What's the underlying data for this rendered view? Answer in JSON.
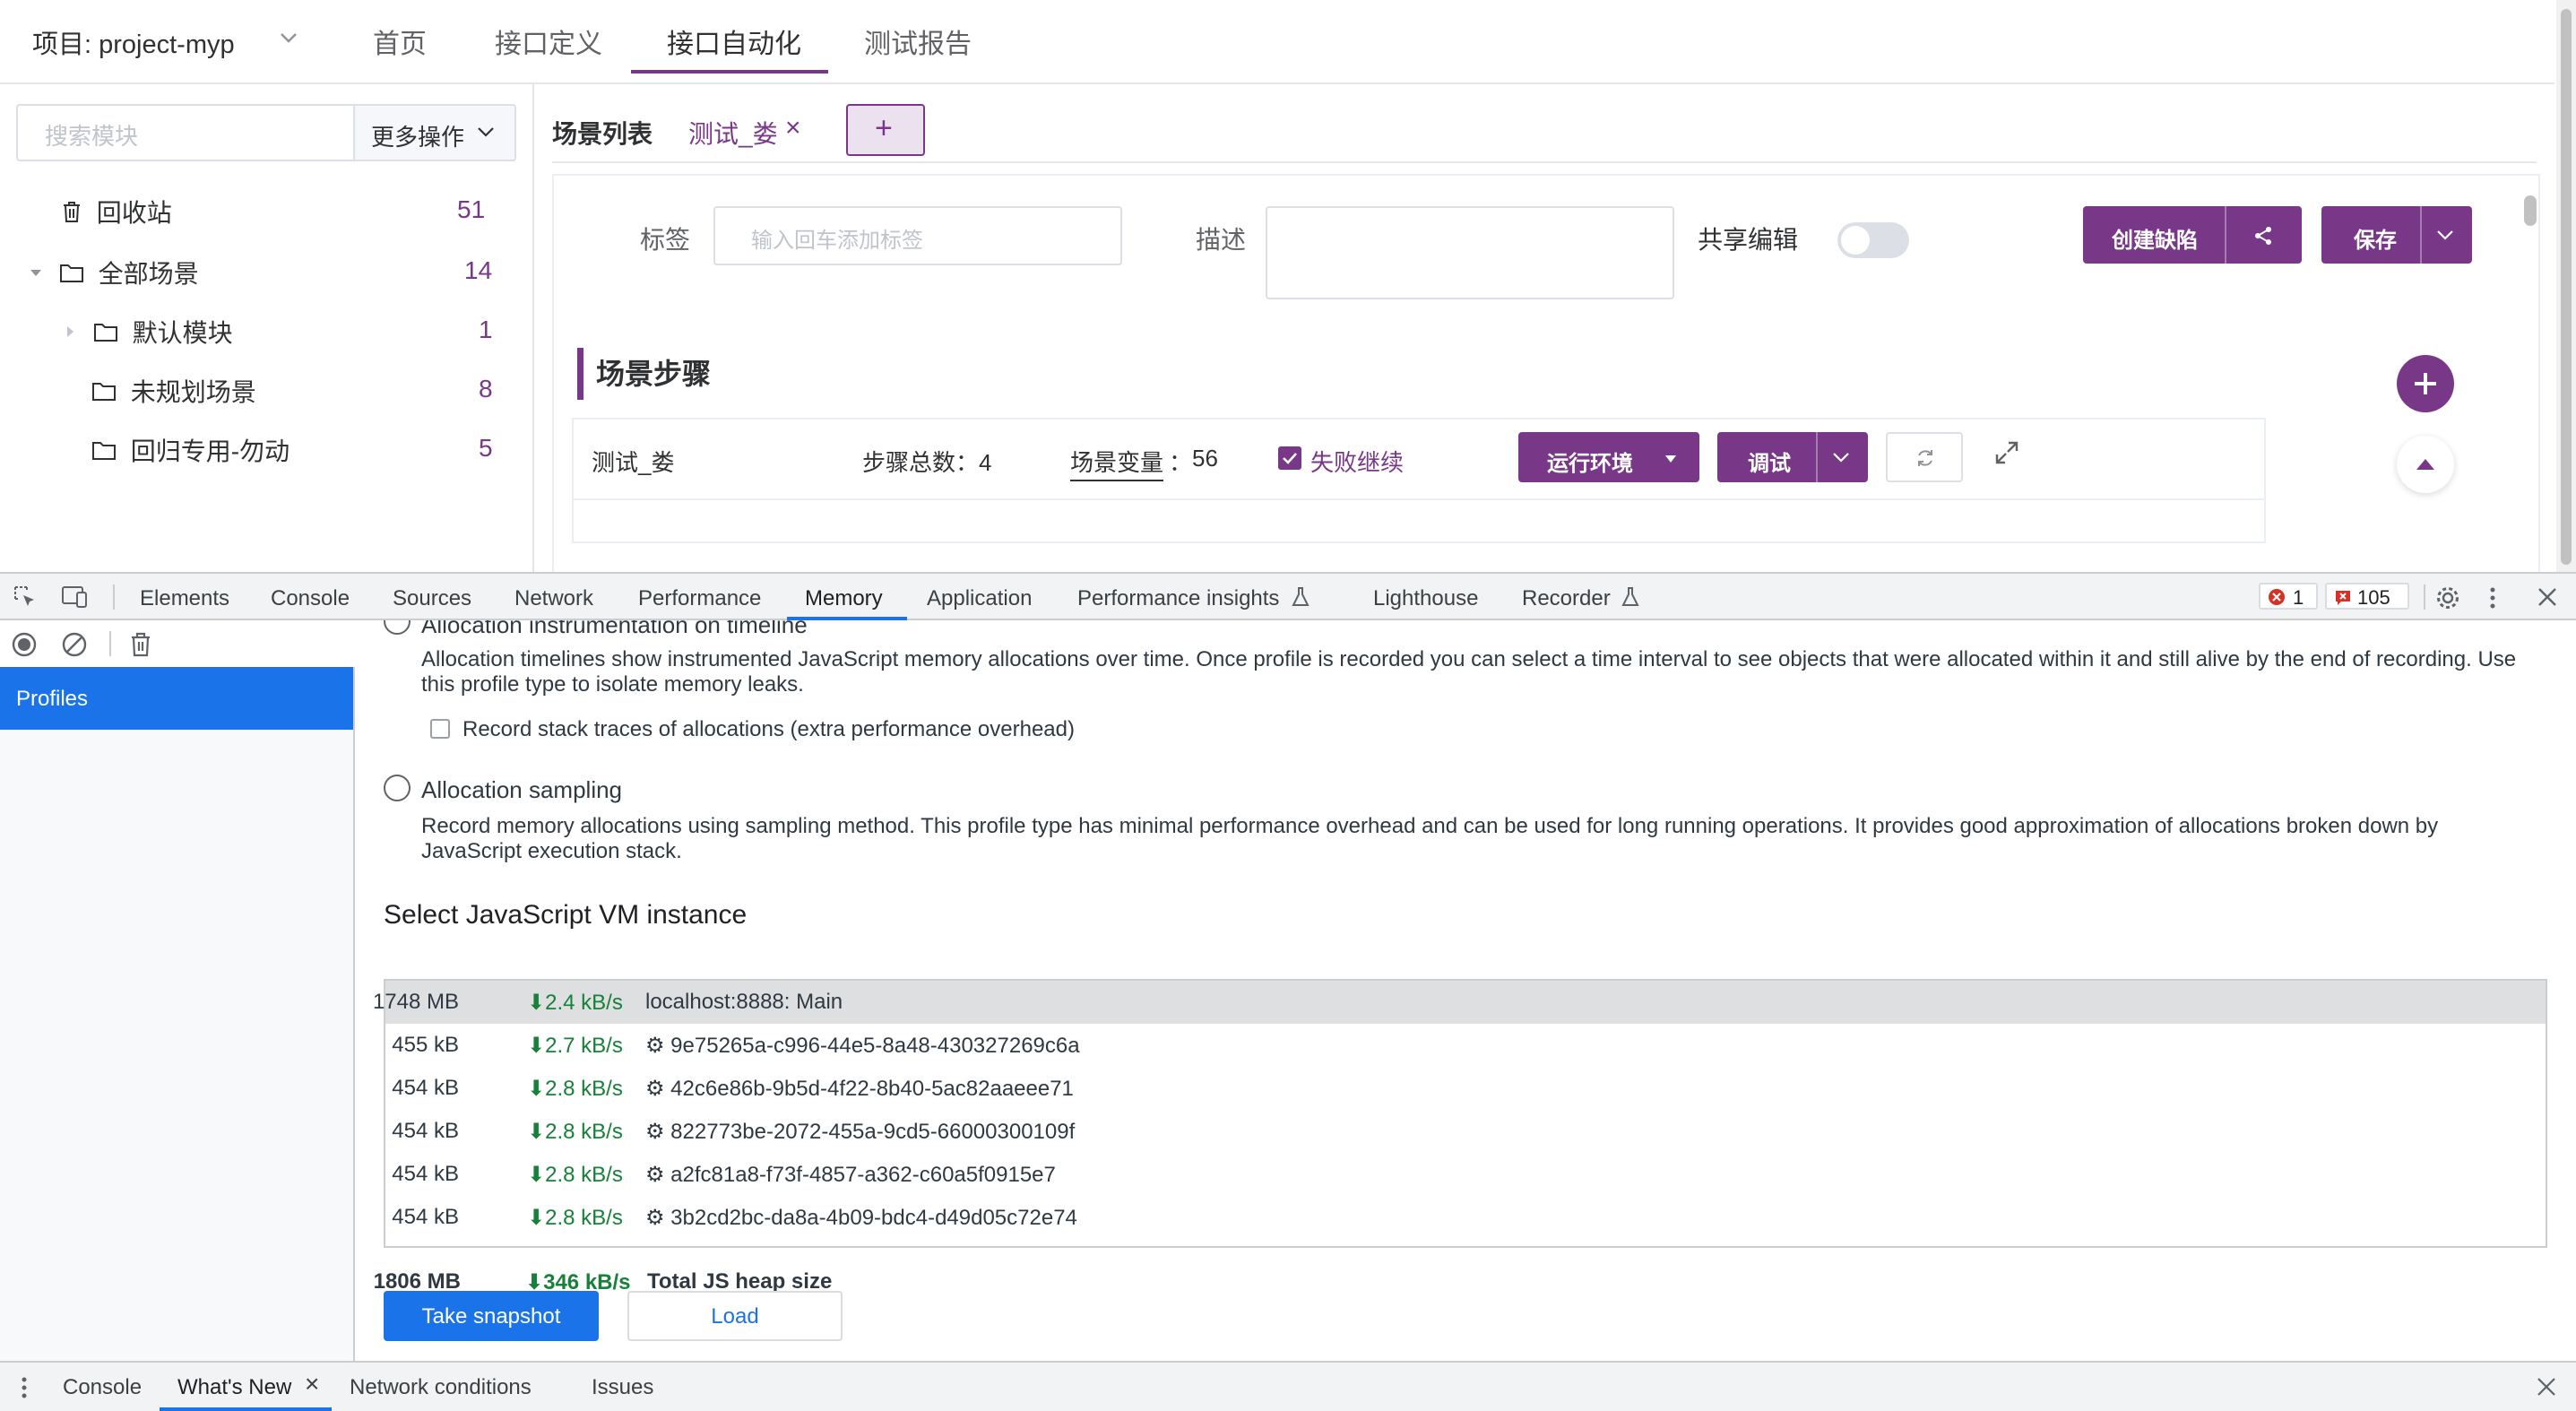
{
  "app": {
    "project_label": "项目: project-myp",
    "nav_tabs": [
      "首页",
      "接口定义",
      "接口自动化",
      "测试报告"
    ],
    "search_placeholder": "搜索模块",
    "more_ops": "更多操作",
    "tree": [
      {
        "label": "回收站",
        "count": "51"
      },
      {
        "label": "全部场景",
        "count": "14"
      },
      {
        "label": "默认模块",
        "count": "1"
      },
      {
        "label": "未规划场景",
        "count": "8"
      },
      {
        "label": "回归专用-勿动",
        "count": "5"
      }
    ],
    "scenario_list_label": "场景列表",
    "scenario_tab": "测试_娄",
    "close_glyph": "×",
    "add_glyph": "+",
    "tag_label": "标签",
    "tag_placeholder": "输入回车添加标签",
    "desc_label": "描述",
    "shared_edit_label": "共享编辑",
    "create_bug": "创建缺陷",
    "save": "保存",
    "steps_title": "场景步骤",
    "scenario_name": "测试_娄",
    "steps_total_label": "步骤总数：",
    "steps_total": "4",
    "scenario_vars_label": "场景变量",
    "vars_colon": "：",
    "scenario_vars": "56",
    "fail_continue": "失败继续",
    "run_env": "运行环境",
    "debug": "调试",
    "accent": "#783887"
  },
  "devtools": {
    "tabs": [
      "Elements",
      "Console",
      "Sources",
      "Network",
      "Performance",
      "Memory",
      "Application",
      "Performance insights",
      "Lighthouse",
      "Recorder"
    ],
    "active_tab": "Memory",
    "error_count": "1",
    "warning_count": "105",
    "sidebar_item": "Profiles",
    "alloc_timeline_title": "Allocation instrumentation on timeline",
    "alloc_timeline_desc_1": "Allocation timelines show instrumented JavaScript memory allocations over time. Once profile is recorded you can select a time interval to see objects that were allocated within it and still alive by the end of recording. Use",
    "alloc_timeline_desc_2": "this profile type to isolate memory leaks.",
    "record_stack": "Record stack traces of allocations (extra performance overhead)",
    "alloc_sampling_title": "Allocation sampling",
    "alloc_sampling_desc_1": "Record memory allocations using sampling method. This profile type has minimal performance overhead and can be used for long running operations. It provides good approximation of allocations broken down by",
    "alloc_sampling_desc_2": "JavaScript execution stack.",
    "vm_heading": "Select JavaScript VM instance",
    "vm_instances": [
      {
        "size": "1748 MB",
        "rate": "⬇2.4 kB/s",
        "name": "localhost:8888: Main"
      },
      {
        "size": "455 kB",
        "rate": "⬇2.7 kB/s",
        "name": "⚙ 9e75265a-c996-44e5-8a48-430327269c6a"
      },
      {
        "size": "454 kB",
        "rate": "⬇2.8 kB/s",
        "name": "⚙ 42c6e86b-9b5d-4f22-8b40-5ac82aaeee71"
      },
      {
        "size": "454 kB",
        "rate": "⬇2.8 kB/s",
        "name": "⚙ 822773be-2072-455a-9cd5-66000300109f"
      },
      {
        "size": "454 kB",
        "rate": "⬇2.8 kB/s",
        "name": "⚙ a2fc81a8-f73f-4857-a362-c60a5f0915e7"
      },
      {
        "size": "454 kB",
        "rate": "⬇2.8 kB/s",
        "name": "⚙ 3b2cd2bc-da8a-4b09-bdc4-d49d05c72e74"
      }
    ],
    "total_size": "1806 MB",
    "total_rate": "⬇346 kB/s",
    "total_label": "Total JS heap size",
    "take_snapshot": "Take snapshot",
    "load": "Load",
    "drawer_tabs": [
      "Console",
      "What's New",
      "Network conditions",
      "Issues"
    ],
    "close_glyph": "×",
    "blue": "#1a73e8"
  }
}
